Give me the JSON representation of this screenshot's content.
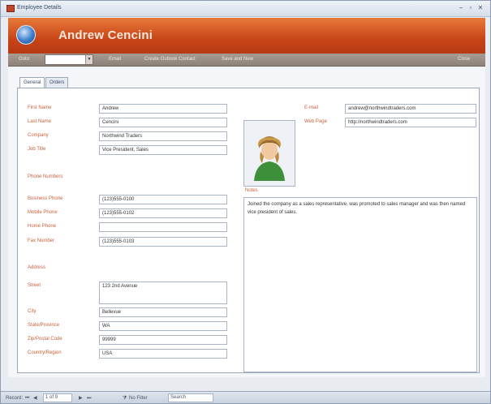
{
  "window": {
    "title": "Employee Details",
    "controls": [
      "–",
      "▫",
      "✕"
    ]
  },
  "header": {
    "title": "Andrew Cencini"
  },
  "toolbar": {
    "goto_label": "Goto",
    "goto_value": "",
    "items": [
      "Email",
      "Create Outlook Contact",
      "Save and New"
    ],
    "close_label": "Close"
  },
  "tabs": [
    "General",
    "Orders"
  ],
  "general": {
    "name_fields": [
      {
        "label": "First Name",
        "value": "Andrew"
      },
      {
        "label": "Last Name",
        "value": "Cencini"
      },
      {
        "label": "Company",
        "value": "Northwind Traders"
      },
      {
        "label": "Job Title",
        "value": "Vice President, Sales"
      }
    ],
    "phone_section": "Phone Numbers",
    "phone_fields": [
      {
        "label": "Business Phone",
        "value": "(123)555-0100"
      },
      {
        "label": "Mobile Phone",
        "value": "(123)555-0102"
      },
      {
        "label": "Home Phone",
        "value": ""
      },
      {
        "label": "Fax Number",
        "value": "(123)555-0103"
      }
    ],
    "address_section": "Address",
    "address_fields": [
      {
        "label": "Street",
        "value": "123 2nd Avenue"
      },
      {
        "label": "City",
        "value": "Bellevue"
      },
      {
        "label": "State/Province",
        "value": "WA"
      },
      {
        "label": "Zip/Postal Code",
        "value": "99999"
      },
      {
        "label": "Country/Region",
        "value": "USA"
      }
    ],
    "email": {
      "label": "E-mail",
      "value": "andrew@northwindtraders.com"
    },
    "web": {
      "label": "Web Page",
      "value": "http://northwindtraders.com"
    },
    "notes_label": "Notes",
    "notes": "Joined the company as a sales representative, was promoted to sales manager and was then named vice president of sales."
  },
  "statusbar": {
    "record_label": "Record:",
    "record_pos": "1 of 9",
    "nav": [
      "⏮",
      "◀",
      "▶",
      "⏭"
    ],
    "filter_label": "No Filter",
    "search_placeholder": "Search"
  }
}
